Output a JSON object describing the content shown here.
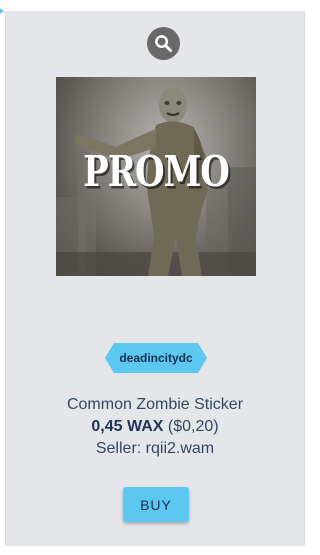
{
  "card": {
    "zoom_icon": "magnifier-icon",
    "image": {
      "overlay_text": "PROMO",
      "depicts": "zombie-figure"
    },
    "collection": "deadincitydc",
    "name": "Common Zombie Sticker",
    "price_wax": "0,45 WAX",
    "price_usd": "($0,20)",
    "seller": "Seller: rqii2.wam",
    "buy_label": "BUY"
  },
  "colors": {
    "accent": "#5cc8f2",
    "card_bg": "#e4e6e9",
    "text": "#34465e",
    "zoom_bg": "#696969"
  }
}
